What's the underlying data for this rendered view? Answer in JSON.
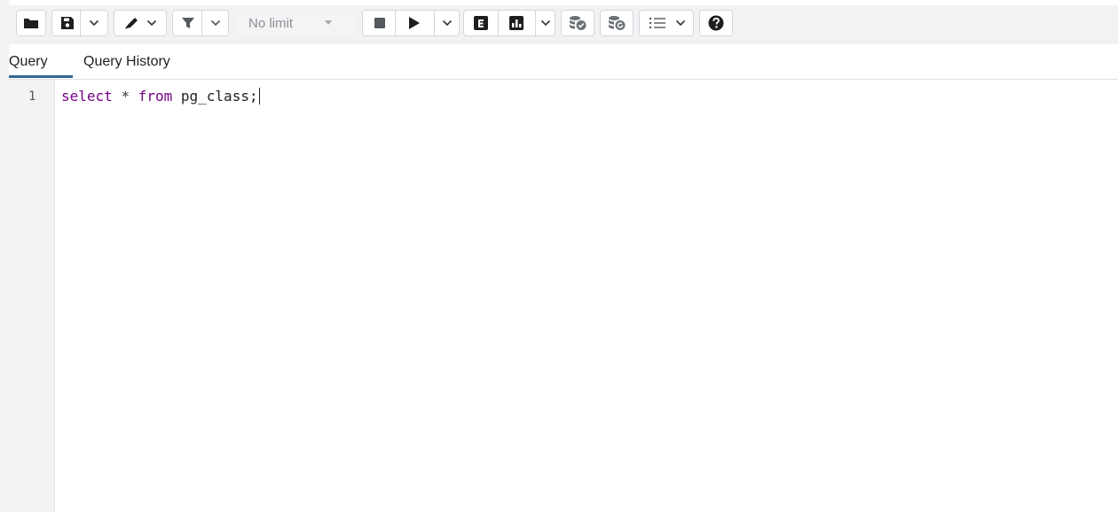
{
  "toolbar": {
    "buttons": [
      {
        "id": "open-file",
        "icon": "folder-icon"
      },
      {
        "id": "save-file",
        "icon": "save-icon"
      },
      {
        "id": "save-options",
        "icon": "chevron-down-icon"
      },
      {
        "id": "edit-menu",
        "icon": "pen-icon"
      },
      {
        "id": "filter",
        "icon": "filter-icon"
      },
      {
        "id": "filter-options",
        "icon": "chevron-down-icon"
      },
      {
        "id": "stop",
        "icon": "stop-icon"
      },
      {
        "id": "execute",
        "icon": "play-icon"
      },
      {
        "id": "execute-options",
        "icon": "chevron-down-icon"
      },
      {
        "id": "explain",
        "icon": "explain-icon"
      },
      {
        "id": "explain-analyze",
        "icon": "chart-icon"
      },
      {
        "id": "explain-options",
        "icon": "chevron-down-icon"
      },
      {
        "id": "commit",
        "icon": "commit-icon"
      },
      {
        "id": "rollback",
        "icon": "rollback-icon"
      },
      {
        "id": "macros",
        "icon": "list-icon"
      },
      {
        "id": "help",
        "icon": "help-icon"
      }
    ],
    "row_limit": {
      "value": "No limit"
    }
  },
  "tabs": [
    {
      "label": "Query",
      "active": true
    },
    {
      "label": "Query History",
      "active": false
    }
  ],
  "editor": {
    "lines": [
      {
        "number": "1",
        "tokens": {
          "select": "select",
          "star": "*",
          "from": "from",
          "rest": "pg_class;"
        }
      }
    ]
  },
  "colors": {
    "keyword": "#770088",
    "tab_accent": "#326690",
    "toolbar_bg": "#f2f2f2"
  }
}
